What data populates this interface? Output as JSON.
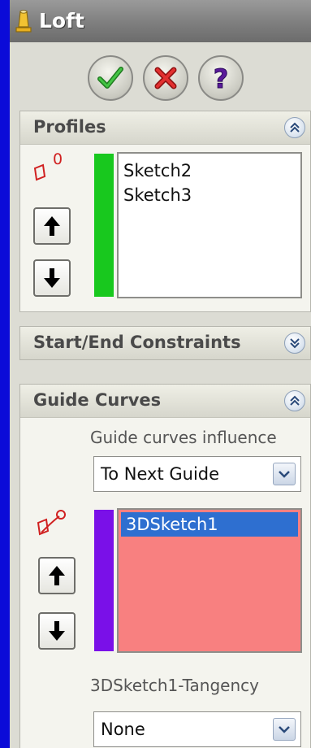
{
  "window": {
    "title": "Loft",
    "icon": "loft-feature-icon"
  },
  "actions": [
    {
      "name": "ok",
      "icon": "checkmark-icon"
    },
    {
      "name": "cancel",
      "icon": "x-icon"
    },
    {
      "name": "help",
      "icon": "question-icon"
    }
  ],
  "profiles": {
    "title": "Profiles",
    "icon_label": "0",
    "items": [
      "Sketch2",
      "Sketch3"
    ],
    "list_color": "#18c81e"
  },
  "start_end": {
    "title": "Start/End Constraints"
  },
  "guide_curves": {
    "title": "Guide Curves",
    "influence_label": "Guide curves influence",
    "influence_value": "To Next Guide",
    "items": [
      "3DSketch1"
    ],
    "list_color": "#7a10e8",
    "list_bg": "#f88080",
    "selected_color": "#2e6fd0",
    "tangency_label": "3DSketch1-Tangency",
    "tangency_value": "None"
  }
}
